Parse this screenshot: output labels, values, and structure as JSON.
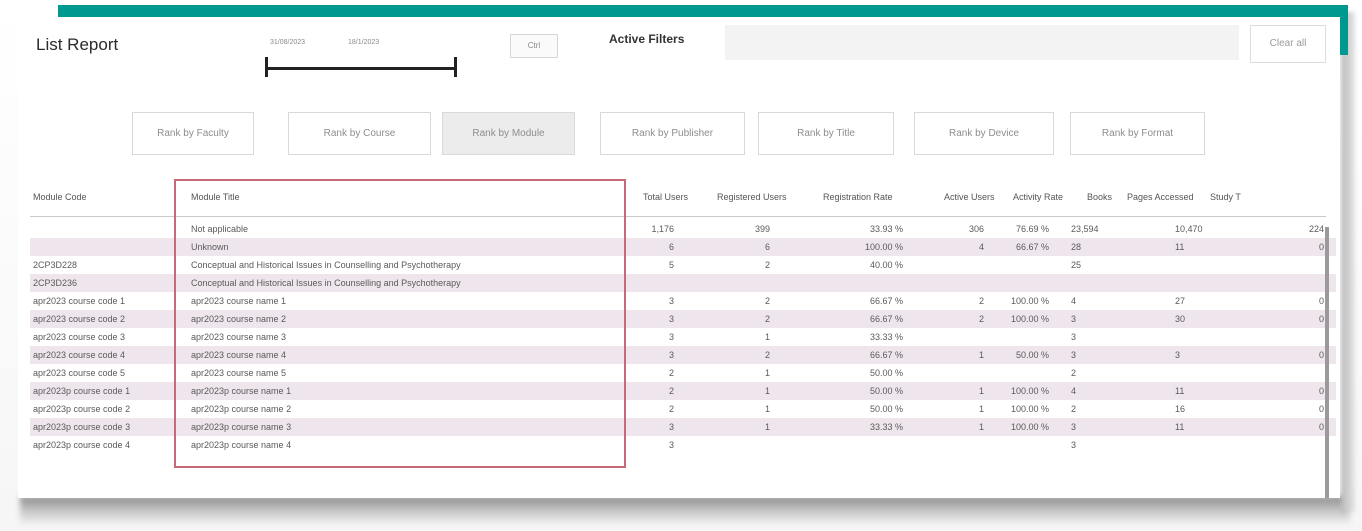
{
  "report": {
    "title": "List Report",
    "date_start": "31/08/2023",
    "date_end": "18/1/2023",
    "small_button": "Ctrl",
    "active_filters_label": "Active Filters",
    "clear_all": "Clear all"
  },
  "rank_buttons": [
    {
      "label": "Rank by Faculty",
      "active": false
    },
    {
      "label": "Rank by Course",
      "active": false
    },
    {
      "label": "Rank by Module",
      "active": true
    },
    {
      "label": "Rank by Publisher",
      "active": false
    },
    {
      "label": "Rank by Title",
      "active": false
    },
    {
      "label": "Rank by Device",
      "active": false
    },
    {
      "label": "Rank by Format",
      "active": false
    }
  ],
  "columns": [
    "Module Code",
    "Module Title",
    "Total Users",
    "Registered Users",
    "Registration Rate",
    "Active Users",
    "Activity Rate",
    "Books",
    "Pages Accessed",
    "Study T"
  ],
  "rows": [
    {
      "code": "",
      "title": "Not applicable",
      "total": "1,176",
      "registered": "399",
      "reg_rate": "33.93 %",
      "active": "306",
      "act_rate": "76.69 %",
      "books": "23,594",
      "pages": "10,470",
      "study": "224"
    },
    {
      "code": "",
      "title": "Unknown",
      "total": "6",
      "registered": "6",
      "reg_rate": "100.00 %",
      "active": "4",
      "act_rate": "66.67 %",
      "books": "28",
      "pages": "11",
      "study": "0"
    },
    {
      "code": "2CP3D228",
      "title": "Conceptual and Historical Issues in Counselling and Psychotherapy",
      "total": "5",
      "registered": "2",
      "reg_rate": "40.00 %",
      "active": "",
      "act_rate": "",
      "books": "25",
      "pages": "",
      "study": ""
    },
    {
      "code": "2CP3D236",
      "title": "Conceptual and Historical Issues in Counselling and Psychotherapy",
      "total": "",
      "registered": "",
      "reg_rate": "",
      "active": "",
      "act_rate": "",
      "books": "",
      "pages": "",
      "study": ""
    },
    {
      "code": "apr2023 course code 1",
      "title": "apr2023 course name 1",
      "total": "3",
      "registered": "2",
      "reg_rate": "66.67 %",
      "active": "2",
      "act_rate": "100.00 %",
      "books": "4",
      "pages": "27",
      "study": "0"
    },
    {
      "code": "apr2023 course code 2",
      "title": "apr2023 course name 2",
      "total": "3",
      "registered": "2",
      "reg_rate": "66.67 %",
      "active": "2",
      "act_rate": "100.00 %",
      "books": "3",
      "pages": "30",
      "study": "0"
    },
    {
      "code": "apr2023 course code 3",
      "title": "apr2023 course name 3",
      "total": "3",
      "registered": "1",
      "reg_rate": "33.33 %",
      "active": "",
      "act_rate": "",
      "books": "3",
      "pages": "",
      "study": ""
    },
    {
      "code": "apr2023 course code 4",
      "title": "apr2023 course name 4",
      "total": "3",
      "registered": "2",
      "reg_rate": "66.67 %",
      "active": "1",
      "act_rate": "50.00 %",
      "books": "3",
      "pages": "3",
      "study": "0"
    },
    {
      "code": "apr2023 course code 5",
      "title": "apr2023 course name 5",
      "total": "2",
      "registered": "1",
      "reg_rate": "50.00 %",
      "active": "",
      "act_rate": "",
      "books": "2",
      "pages": "",
      "study": ""
    },
    {
      "code": "apr2023p course code 1",
      "title": "apr2023p course name 1",
      "total": "2",
      "registered": "1",
      "reg_rate": "50.00 %",
      "active": "1",
      "act_rate": "100.00 %",
      "books": "4",
      "pages": "11",
      "study": "0"
    },
    {
      "code": "apr2023p course code 2",
      "title": "apr2023p course name 2",
      "total": "2",
      "registered": "1",
      "reg_rate": "50.00 %",
      "active": "1",
      "act_rate": "100.00 %",
      "books": "2",
      "pages": "16",
      "study": "0"
    },
    {
      "code": "apr2023p course code 3",
      "title": "apr2023p course name 3",
      "total": "3",
      "registered": "1",
      "reg_rate": "33.33 %",
      "active": "1",
      "act_rate": "100.00 %",
      "books": "3",
      "pages": "11",
      "study": "0"
    },
    {
      "code": "apr2023p course code 4",
      "title": "apr2023p course name 4",
      "total": "3",
      "registered": "",
      "reg_rate": "",
      "active": "",
      "act_rate": "",
      "books": "3",
      "pages": "",
      "study": ""
    }
  ]
}
